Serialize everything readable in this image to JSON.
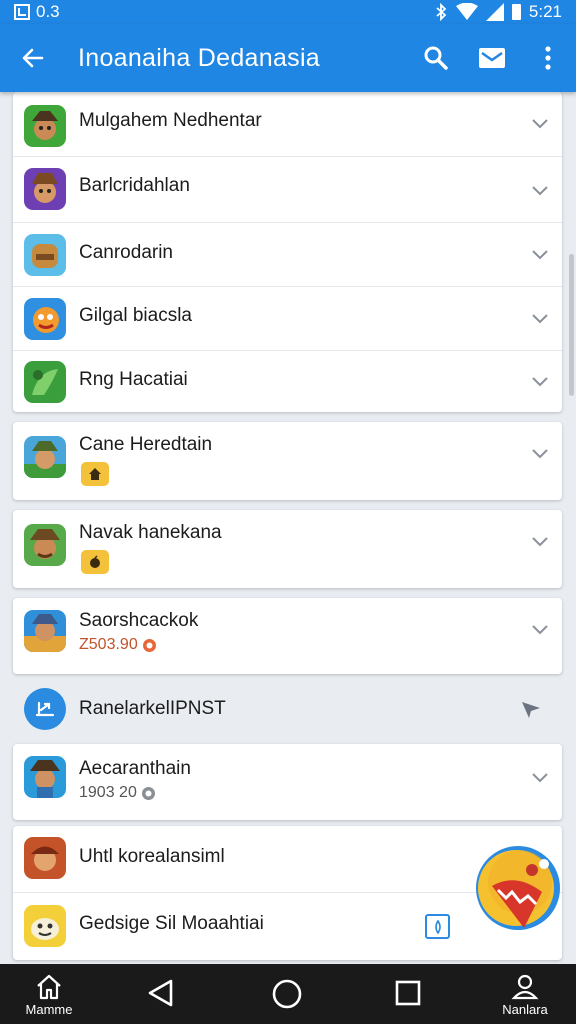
{
  "status_bar": {
    "left_text": "0.3",
    "time": "5:21"
  },
  "app_bar": {
    "title": "Inoanaiha Dedanasia"
  },
  "rows": [
    {
      "title": "Mulgahem Nedhentar"
    },
    {
      "title": "Barlcridahlan"
    },
    {
      "title": "Canrodarin"
    },
    {
      "title": "Gilgal biacsla"
    },
    {
      "title": "Rng Hacatiai"
    },
    {
      "title": "Cane Heredtain"
    },
    {
      "title": "Navak hanekana"
    },
    {
      "title": "Saorshcackok",
      "subtitle": "Z503.90"
    },
    {
      "title": "RanelarkelIPNST"
    },
    {
      "title": "Aecaranthain",
      "subtitle": "1903 20"
    },
    {
      "title": "Uhtl korealansiml"
    },
    {
      "title": "Gedsige Sil Moaahtiai"
    }
  ],
  "nav": {
    "home_label": "Mamme",
    "profile_label": "Nanlara"
  },
  "colors": {
    "primary": "#1f86e3",
    "subtitle_red": "#c0532a",
    "badge_yellow": "#f4c23a"
  }
}
